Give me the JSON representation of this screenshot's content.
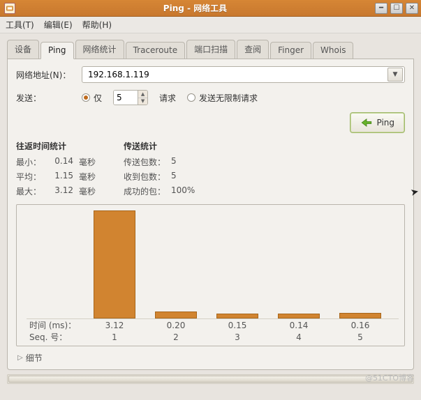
{
  "window": {
    "title": "Ping - 网络工具",
    "minimize_tip": "最小化",
    "maximize_tip": "最大化",
    "close_tip": "关闭"
  },
  "menubar": {
    "tool": "工具(T)",
    "edit": "编辑(E)",
    "help": "帮助(H)"
  },
  "tabs": {
    "items": [
      {
        "label": "设备"
      },
      {
        "label": "Ping"
      },
      {
        "label": "网络统计"
      },
      {
        "label": "Traceroute"
      },
      {
        "label": "端口扫描"
      },
      {
        "label": "查阅"
      },
      {
        "label": "Finger"
      },
      {
        "label": "Whois"
      }
    ],
    "active_index": 1
  },
  "form": {
    "address_label": "网络地址(N)：",
    "address_value": "192.168.1.119",
    "send_label": "发送：",
    "radio_only_label": "仅",
    "count_value": "5",
    "requests_word": "请求",
    "radio_unlimited_label": "发送无限制请求",
    "ping_button": "Ping"
  },
  "stats": {
    "rtt_header": "往返时间统计",
    "rtt_unit": "毫秒",
    "rtt": {
      "min_label": "最小：",
      "min_value": "0.14",
      "avg_label": "平均：",
      "avg_value": "1.15",
      "max_label": "最大：",
      "max_value": "3.12"
    },
    "tx_header": "传送统计",
    "tx": {
      "sent_label": "传送包数：",
      "sent_value": "5",
      "recv_label": "收到包数：",
      "recv_value": "5",
      "succ_label": "成功的包：",
      "succ_value": "100%"
    }
  },
  "chart_data": {
    "type": "bar",
    "time_axis_label": "时间 (ms)：",
    "seq_axis_label": "Seq. 号：",
    "categories": [
      "1",
      "2",
      "3",
      "4",
      "5"
    ],
    "values": [
      3.12,
      0.2,
      0.15,
      0.14,
      0.16
    ],
    "value_labels": [
      "3.12",
      "0.20",
      "0.15",
      "0.14",
      "0.16"
    ],
    "ylim": [
      0,
      3.12
    ]
  },
  "details_label": "细节",
  "watermark": "@51CTO博客"
}
